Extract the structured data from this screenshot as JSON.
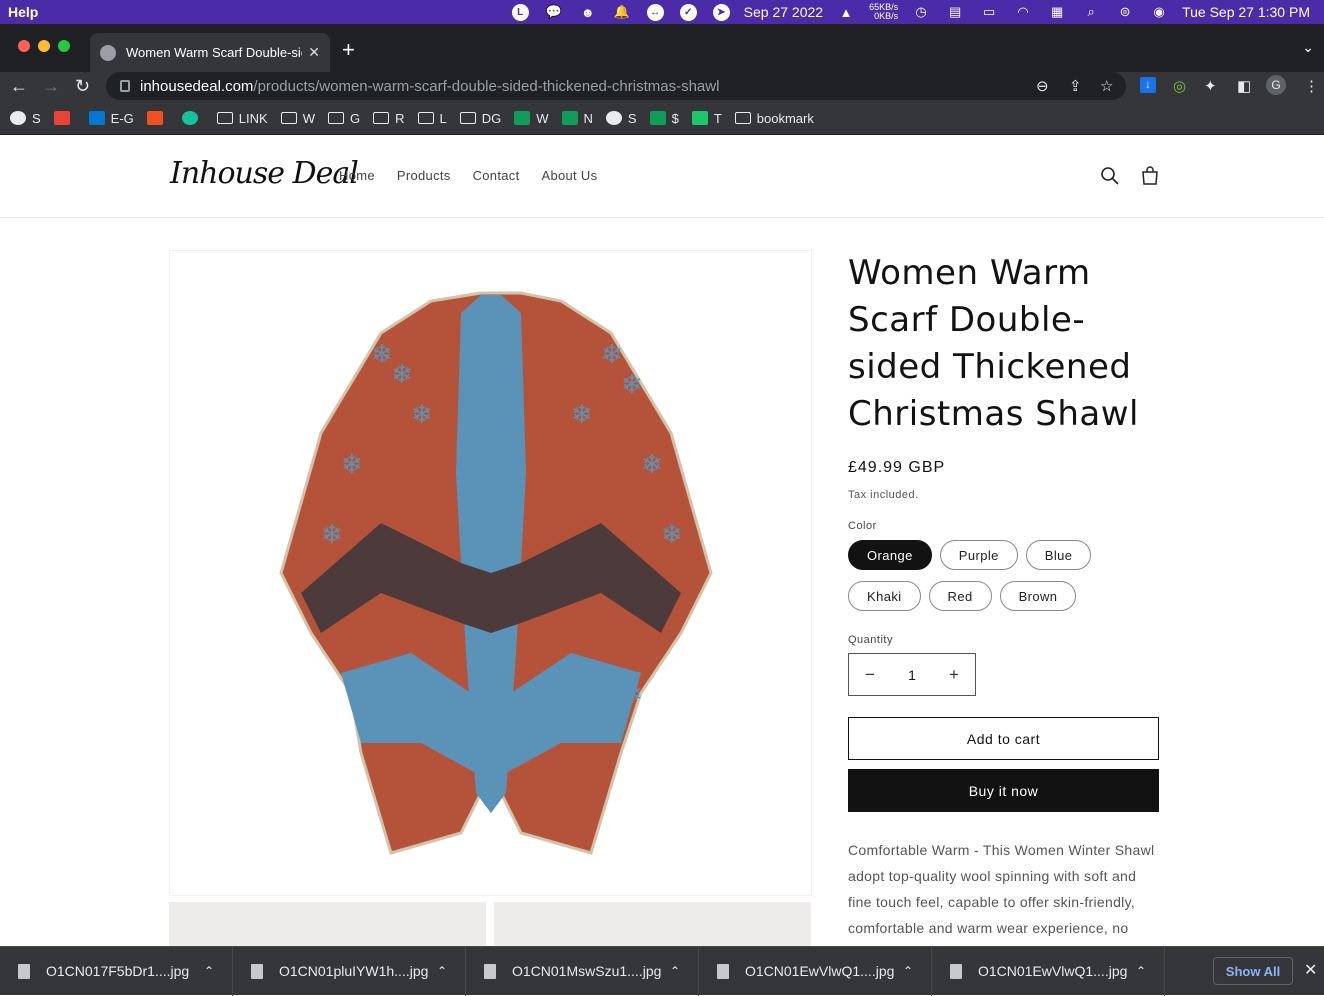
{
  "menubar": {
    "app_menu": "Help",
    "date_widget": "Sep 27 2022",
    "net_up": "65KB/s",
    "net_down": "0KB/s",
    "clock": "Tue Sep 27  1:30 PM",
    "icons": [
      "line-icon",
      "wechat-icon",
      "viking-icon",
      "notification-icon",
      "teamviewer-icon",
      "checkmark-icon",
      "send-icon",
      "cat-icon",
      "time-machine-icon",
      "us-flag-icon",
      "battery-icon",
      "wifi-icon",
      "keyboard-icon",
      "spotlight-icon",
      "control-center-icon",
      "siri-icon"
    ]
  },
  "browser": {
    "tab_title": "Women Warm Scarf Double-sided Thickened Christmas Shawl",
    "url_domain": "inhousedeal.com",
    "url_path": "/products/women-warm-scarf-double-sided-thickened-christmas-shawl",
    "profile_initial": "G"
  },
  "bookmarks": [
    {
      "label": "S",
      "icon": "globe-icon"
    },
    {
      "label": "",
      "icon": "gmail-icon"
    },
    {
      "label": "E-G",
      "icon": "outlook-icon"
    },
    {
      "label": "",
      "icon": "microsoft-icon"
    },
    {
      "label": "",
      "icon": "grammarly-icon"
    },
    {
      "label": "LINK",
      "icon": "folder-icon"
    },
    {
      "label": "W",
      "icon": "folder-icon"
    },
    {
      "label": "G",
      "icon": "folder-icon"
    },
    {
      "label": "R",
      "icon": "folder-icon"
    },
    {
      "label": "L",
      "icon": "folder-icon"
    },
    {
      "label": "DG",
      "icon": "folder-icon"
    },
    {
      "label": "W",
      "icon": "sheets-icon"
    },
    {
      "label": "N",
      "icon": "sheets-icon"
    },
    {
      "label": "S",
      "icon": "globe-icon"
    },
    {
      "label": "$",
      "icon": "sheets-icon"
    },
    {
      "label": "T",
      "icon": "star-icon"
    },
    {
      "label": "bookmark",
      "icon": "folder-icon"
    }
  ],
  "site": {
    "logo_text": "Inhouse Deal",
    "nav": [
      "Home",
      "Products",
      "Contact",
      "About Us"
    ]
  },
  "product": {
    "title": "Women Warm Scarf Double-sided Thickened Christmas Shawl",
    "price": "£49.99 GBP",
    "tax_note": "Tax included.",
    "color_label": "Color",
    "colors": [
      "Orange",
      "Purple",
      "Blue",
      "Khaki",
      "Red",
      "Brown"
    ],
    "selected_color": "Orange",
    "quantity_label": "Quantity",
    "quantity": "1",
    "add_to_cart": "Add to cart",
    "buy_now": "Buy it now",
    "description": "Comfortable Warm - This Women Winter Shawl adopt top-quality wool spinning with soft and fine touch feel, capable to offer skin-friendly, comfortable and warm wear experience, no need to worry about color fading and fuzzing"
  },
  "downloads": {
    "files": [
      "O1CN017F5bDr1....jpg",
      "O1CN01pluIYW1h....jpg",
      "O1CN01MswSzu1....jpg",
      "O1CN01EwVlwQ1....jpg",
      "O1CN01EwVlwQ1....jpg"
    ],
    "show_all": "Show All"
  },
  "colors": {
    "menubar_bg": "#4b2ba8",
    "shawl_rust": "#b5533a",
    "shawl_blue": "#5b93b8",
    "shawl_brown": "#4d3a3a"
  }
}
